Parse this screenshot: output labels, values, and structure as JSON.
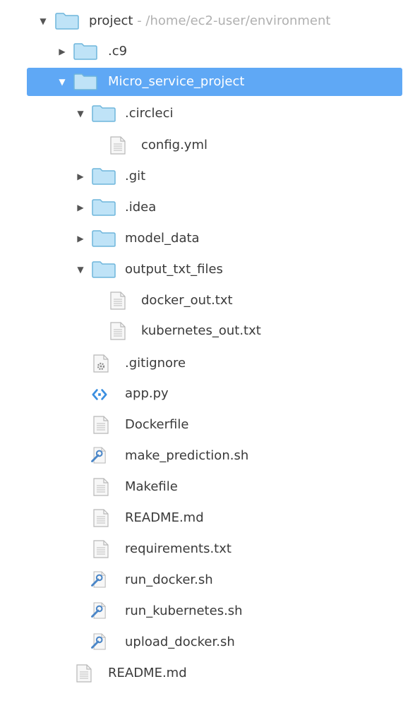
{
  "root": {
    "name": "project",
    "path": " - /home/ec2-user/environment"
  },
  "items": [
    {
      "label": ".c9"
    },
    {
      "label": "Micro_service_project"
    },
    {
      "label": ".circleci"
    },
    {
      "label": "config.yml"
    },
    {
      "label": ".git"
    },
    {
      "label": ".idea"
    },
    {
      "label": "model_data"
    },
    {
      "label": "output_txt_files"
    },
    {
      "label": "docker_out.txt"
    },
    {
      "label": "kubernetes_out.txt"
    },
    {
      "label": ".gitignore"
    },
    {
      "label": "app.py"
    },
    {
      "label": "Dockerfile"
    },
    {
      "label": "make_prediction.sh"
    },
    {
      "label": "Makefile"
    },
    {
      "label": "README.md"
    },
    {
      "label": "requirements.txt"
    },
    {
      "label": "run_docker.sh"
    },
    {
      "label": "run_kubernetes.sh"
    },
    {
      "label": "upload_docker.sh"
    },
    {
      "label": "README.md"
    }
  ],
  "colors": {
    "selection": "#5fa8f5",
    "folder": "#bfe3f7",
    "folder_border": "#6fb6dc"
  }
}
